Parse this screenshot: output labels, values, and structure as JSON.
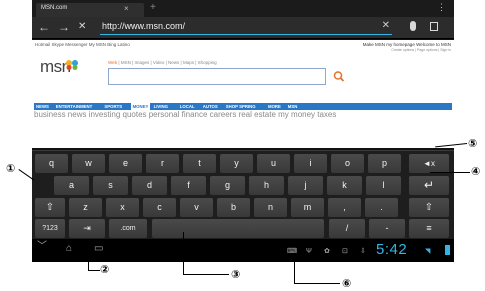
{
  "tab": {
    "title": "MSN.com",
    "close": "×",
    "new": "+"
  },
  "menu": "⋮",
  "urlbar": {
    "back": "←",
    "forward": "→",
    "stop": "✕",
    "url": "http://www.msn.com/",
    "clear": "✕"
  },
  "page": {
    "toplinks": "Hotmail   Skype   Messenger   My MSN   Bing   Latino",
    "topright": "Make MSN my homepage   Welcome to MSN",
    "topright2": "Create options | Page options | Sign in",
    "logo": "msn",
    "search_tabs": {
      "web": "Web",
      "rest": " | MSN | Images | Video | News | Maps | Shopping"
    },
    "nav": [
      "NEWS",
      "ENTERTAINMENT",
      "SPORTS",
      "MONEY",
      "LIVING",
      "LOCAL",
      "AUTOS",
      "SHOP SPRING",
      "MORE",
      "MSN"
    ],
    "sublinks": "business news   investing   quotes   personal finance   careers   real estate   my money   taxes"
  },
  "keyboard": {
    "row1": [
      "q",
      "w",
      "e",
      "r",
      "t",
      "y",
      "u",
      "i",
      "o",
      "p"
    ],
    "row2": [
      "a",
      "s",
      "d",
      "f",
      "g",
      "h",
      "j",
      "k",
      "l"
    ],
    "row3": [
      "z",
      "x",
      "c",
      "v",
      "b",
      "n",
      "m",
      ",",
      "."
    ],
    "delete": "◄x",
    "enter": "↵",
    "shift": "⇧",
    "shift_right": "⇧",
    "symbols": "?123",
    "tab": "⇥",
    "com": ".com",
    "slash": "/",
    "dash": "-",
    "settings": "≡"
  },
  "system": {
    "hide": "﹀",
    "home": "⌂",
    "recents": "▭",
    "clock": "5:42"
  },
  "callouts": [
    "①",
    "②",
    "③",
    "④",
    "⑤",
    "⑥"
  ],
  "colors": {
    "accent": "#33b5e5",
    "keyboard": "#1e1e1e",
    "key": "#404040",
    "msn_nav": "#2a78c5"
  }
}
